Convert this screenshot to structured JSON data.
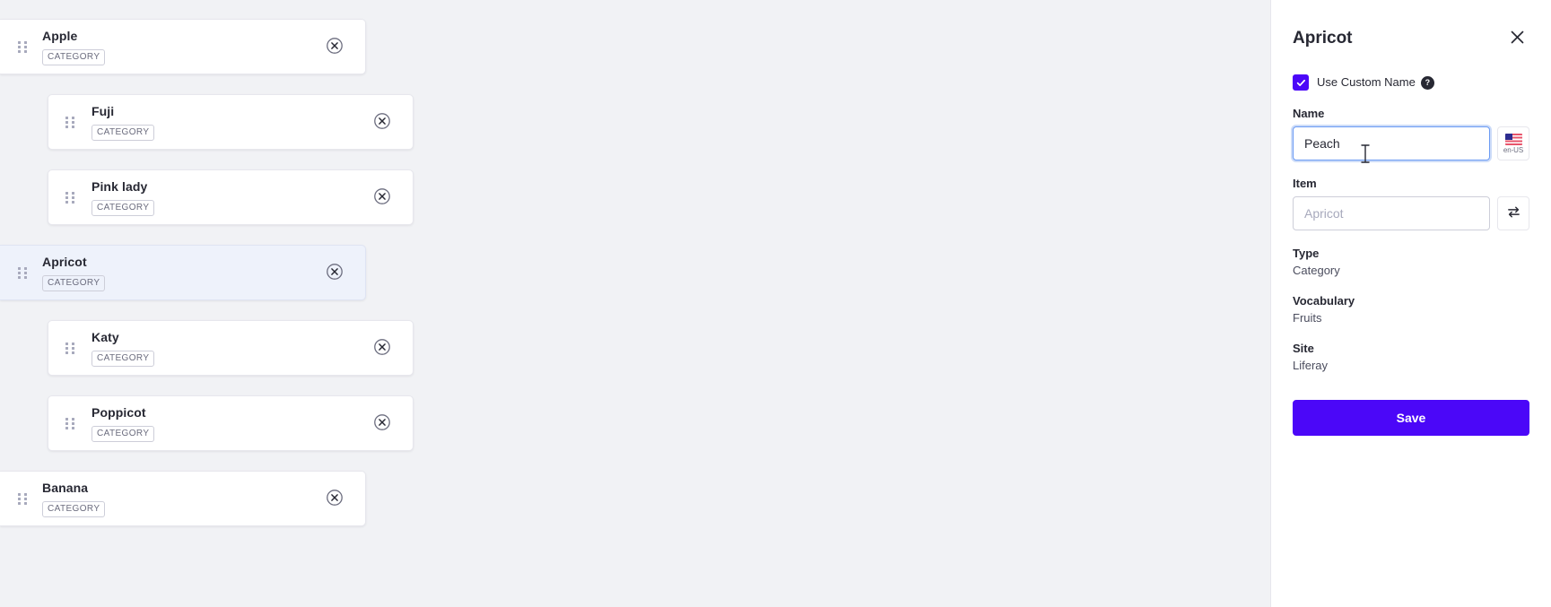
{
  "tree": {
    "items": [
      {
        "title": "Apple",
        "label": "CATEGORY",
        "level": 0,
        "selected": false
      },
      {
        "title": "Fuji",
        "label": "CATEGORY",
        "level": 1,
        "selected": false
      },
      {
        "title": "Pink lady",
        "label": "CATEGORY",
        "level": 1,
        "selected": false
      },
      {
        "title": "Apricot",
        "label": "CATEGORY",
        "level": 0,
        "selected": true
      },
      {
        "title": "Katy",
        "label": "CATEGORY",
        "level": 1,
        "selected": false
      },
      {
        "title": "Poppicot",
        "label": "CATEGORY",
        "level": 1,
        "selected": false
      },
      {
        "title": "Banana",
        "label": "CATEGORY",
        "level": 0,
        "selected": false
      }
    ]
  },
  "sidebar": {
    "title": "Apricot",
    "custom_name": {
      "checked": true,
      "label": "Use Custom Name",
      "help": "?"
    },
    "name_field": {
      "label": "Name",
      "value": "Peach",
      "placeholder": ""
    },
    "language_button": {
      "label": "en-US"
    },
    "item_field": {
      "label": "Item",
      "value": "",
      "placeholder": "Apricot"
    },
    "info": [
      {
        "label": "Type",
        "value": "Category"
      },
      {
        "label": "Vocabulary",
        "value": "Fruits"
      },
      {
        "label": "Site",
        "value": "Liferay"
      }
    ],
    "save_label": "Save"
  },
  "colors": {
    "accent": "#4b07f8",
    "selected_row": "#eef2fb",
    "page_bg": "#f1f2f5",
    "focus_ring": "#cddcf8"
  }
}
